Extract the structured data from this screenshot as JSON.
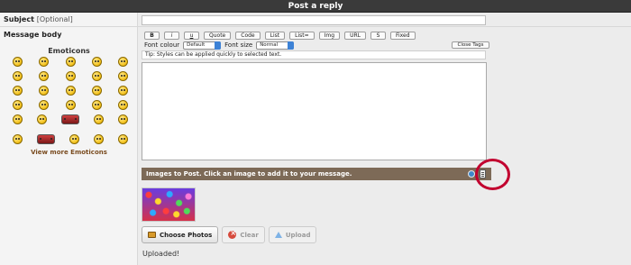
{
  "header": {
    "title": "Post a reply"
  },
  "subject": {
    "label": "Subject",
    "optional": "[Optional]",
    "value": ""
  },
  "message": {
    "label": "Message body"
  },
  "emoticons": {
    "title": "Emoticons",
    "view_more": "View more Emoticons",
    "rows": [
      [
        "smile-emoticon",
        "wink-emoticon",
        "grin-emoticon",
        "laugh-emoticon",
        "cool-emoticon"
      ],
      [
        "shocked-emoticon",
        "sunglasses-emoticon",
        "tongue-emoticon",
        "sad-emoticon",
        "angry-emoticon"
      ],
      [
        "blush-emoticon",
        "devil-emoticon",
        "confused-emoticon",
        "crying-emoticon",
        "kiss-emoticon"
      ],
      [
        "unsure-emoticon",
        "exclaim-emoticon",
        "question-emoticon",
        "idea-emoticon",
        "arrow-emoticon"
      ],
      [
        "neutral-emoticon",
        "eyeroll-emoticon",
        "banner-emoticon",
        "thumbsup-emoticon",
        "scream-emoticon"
      ]
    ],
    "extra": [
      "bird-emoticon",
      "chase-emoticon",
      "alien-emoticon",
      "dizzy-emoticon",
      "hug-emoticon"
    ]
  },
  "toolbar": {
    "buttons": [
      "B",
      "i",
      "u",
      "Quote",
      "Code",
      "List",
      "List=",
      "Img",
      "URL",
      "S",
      "Fixed"
    ],
    "font_colour_label": "Font colour",
    "font_colour_value": "Default",
    "font_size_label": "Font size",
    "font_size_value": "Normal",
    "close_tags": "Close Tags"
  },
  "tip": "Tip: Styles can be applied quickly to selected text.",
  "images": {
    "bar_text": "Images to Post. Click an image to add it to your message.",
    "bar_icons": [
      "refresh-icon",
      "document-icon"
    ],
    "annotation_color": "#c2002f"
  },
  "upload": {
    "choose_label": "Choose Photos",
    "clear_label": "Clear",
    "upload_label": "Upload",
    "status": "Uploaded!"
  },
  "colors": {
    "title_bar": "#3a3a3a",
    "images_bar": "#7d6a57",
    "link": "#7a4c20"
  }
}
